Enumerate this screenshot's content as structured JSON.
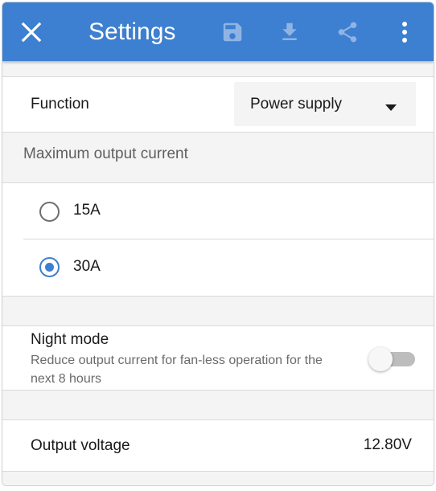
{
  "toolbar": {
    "title": "Settings",
    "background": "#3d7fd0",
    "icons": {
      "close": "close-icon",
      "save": "save-icon",
      "download": "download-icon",
      "share": "share-icon",
      "more": "more-vert-icon"
    },
    "disabled_icon_color": "#8fb4e4"
  },
  "function_row": {
    "label": "Function",
    "selected": "Power supply",
    "arrow_icon": "dropdown-arrow-icon"
  },
  "max_current": {
    "header": "Maximum output current",
    "options": [
      {
        "label": "15A",
        "selected": false
      },
      {
        "label": "30A",
        "selected": true
      }
    ],
    "accent": "#3d7fd0"
  },
  "night_mode": {
    "title": "Night mode",
    "description": "Reduce output current for fan-less operation for the next 8 hours",
    "enabled": false
  },
  "output_voltage": {
    "label": "Output voltage",
    "value": "12.80V"
  }
}
